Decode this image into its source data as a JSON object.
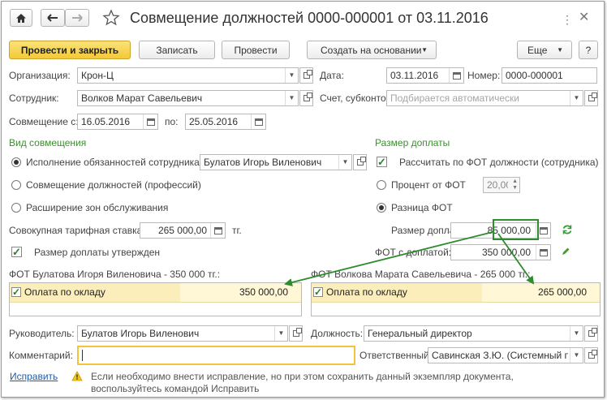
{
  "header": {
    "title": "Совмещение должностей 0000-000001 от 03.11.2016"
  },
  "toolbar": {
    "post_close": "Провести и закрыть",
    "save": "Записать",
    "post": "Провести",
    "create_based": "Создать на основании",
    "more": "Еще",
    "help": "?"
  },
  "form": {
    "org_label": "Организация:",
    "org_value": "Крон-Ц",
    "date_label": "Дата:",
    "date_value": "03.11.2016",
    "number_label": "Номер:",
    "number_value": "0000-000001",
    "employee_label": "Сотрудник:",
    "employee_value": "Волков Марат Савельевич",
    "account_label": "Счет, субконто:",
    "account_placeholder": "Подбирается автоматически",
    "period_from_label": "Совмещение с:",
    "period_from": "16.05.2016",
    "period_to_label": "по:",
    "period_to": "25.05.2016"
  },
  "kind": {
    "title": "Вид совмещения",
    "options": [
      "Исполнение обязанностей сотрудника",
      "Совмещение должностей (профессий)",
      "Расширение зон обслуживания"
    ],
    "selected_index": 0,
    "substitute_value": "Булатов Игорь Виленович",
    "total_rate_label": "Совокупная тарифная ставка:",
    "total_rate_value": "265 000,00",
    "total_rate_unit": "тг.",
    "approved_label": "Размер доплаты утвержден"
  },
  "surcharge": {
    "title": "Размер доплаты",
    "calc_fot_label": "Рассчитать по ФОТ должности (сотрудника)",
    "percent_label": "Процент от ФОТ",
    "percent_value": "20,00",
    "diff_label": "Разница ФОТ",
    "amount_label": "Размер доплаты:",
    "amount_value": "85 000,00",
    "fot_with_label": "ФОТ с доплатой:",
    "fot_with_value": "350 000,00"
  },
  "fot_left": {
    "title": "ФОТ Булатова Игоря Виленовича - 350 000 тг.:",
    "row_label": "Оплата по окладу",
    "row_value": "350 000,00"
  },
  "fot_right": {
    "title": "ФОТ Волкова Марата Савельевича - 265 000 тг.:",
    "row_label": "Оплата по окладу",
    "row_value": "265 000,00"
  },
  "footer": {
    "manager_label": "Руководитель:",
    "manager_value": "Булатов Игорь Виленович",
    "position_label": "Должность:",
    "position_value": "Генеральный директор",
    "comment_label": "Комментарий:",
    "comment_value": "",
    "responsible_label": "Ответственный:",
    "responsible_value": "Савинская З.Ю. (Системный прог",
    "fix_link": "Исправить",
    "warning": "Если необходимо внести исправление, но при этом сохранить данный экземпляр документа, воспользуйтесь командой Исправить"
  },
  "colors": {
    "accent_green": "#3b8f2e",
    "primary_button": "#f3c935",
    "row_highlight": "#fbeebb",
    "arrow": "#2e8b2e"
  }
}
